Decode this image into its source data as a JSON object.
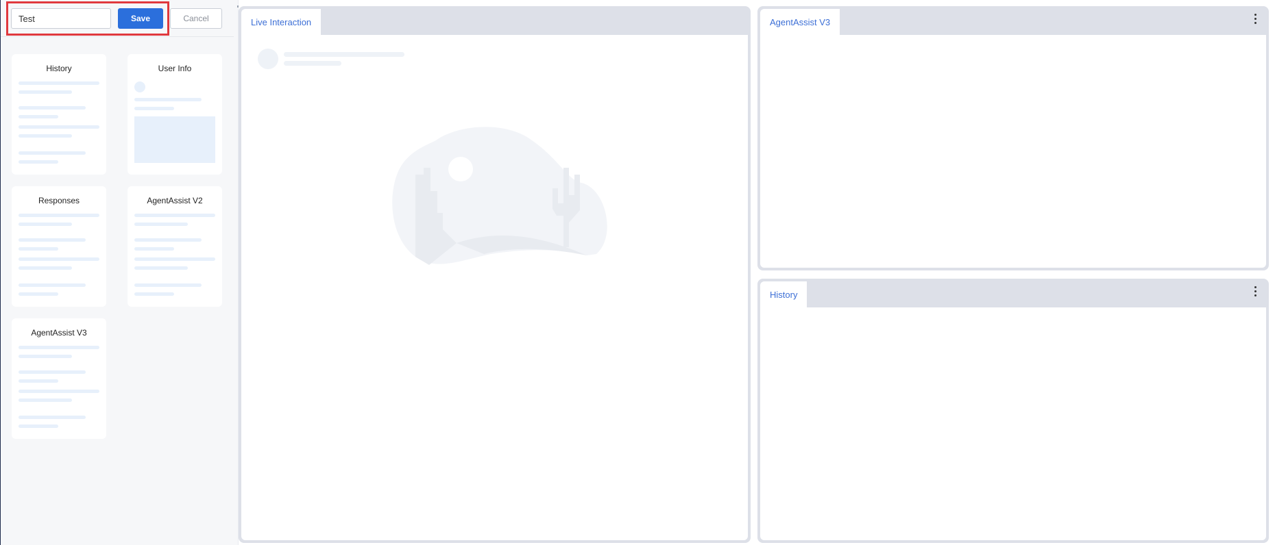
{
  "toolbar": {
    "name_value": "Test",
    "save_label": "Save",
    "cancel_label": "Cancel"
  },
  "widget_palette": {
    "cards": [
      {
        "title": "History"
      },
      {
        "title": "User Info"
      },
      {
        "title": "Responses"
      },
      {
        "title": "AgentAssist V2"
      },
      {
        "title": "AgentAssist V3"
      }
    ]
  },
  "panels": {
    "live": {
      "tab_label": "Live Interaction"
    },
    "agent_assist": {
      "tab_label": "AgentAssist V3"
    },
    "history": {
      "tab_label": "History"
    }
  },
  "colors": {
    "accent": "#2b6fdc",
    "highlight": "#e0393e",
    "tab_text": "#3c6fd6"
  },
  "icons": {
    "panel_menu": "kebab-menu-icon",
    "empty_state": "desert-illustration"
  }
}
